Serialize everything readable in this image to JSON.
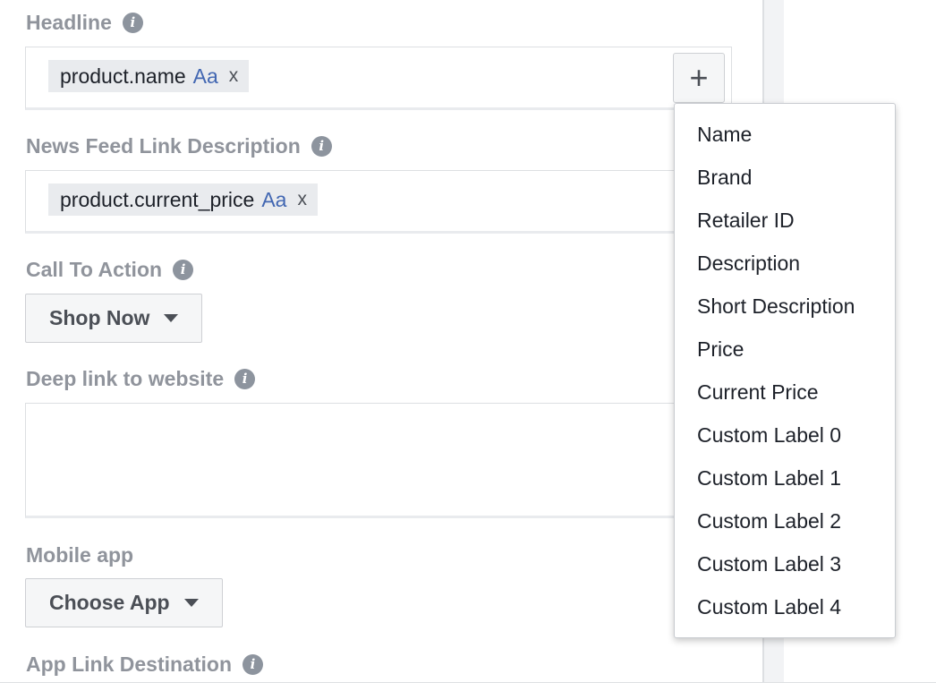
{
  "fields": {
    "headline": {
      "label": "Headline",
      "token": "product.name",
      "token_style": "Aa",
      "token_remove": "x"
    },
    "link_description": {
      "label": "News Feed Link Description",
      "token": "product.current_price",
      "token_style": "Aa",
      "token_remove": "x"
    },
    "call_to_action": {
      "label": "Call To Action",
      "value": "Shop Now"
    },
    "deep_link": {
      "label": "Deep link to website",
      "value": ""
    },
    "mobile_app": {
      "label": "Mobile app",
      "value": "Choose App"
    },
    "app_link_destination": {
      "label": "App Link Destination"
    }
  },
  "add_button": {
    "symbol": "+"
  },
  "menu": {
    "items": [
      "Name",
      "Brand",
      "Retailer ID",
      "Description",
      "Short Description",
      "Price",
      "Current Price",
      "Custom Label 0",
      "Custom Label 1",
      "Custom Label 2",
      "Custom Label 3",
      "Custom Label 4"
    ]
  },
  "icons": {
    "info": "info-icon",
    "caret": "caret-down-icon",
    "add": "plus-icon"
  },
  "colors": {
    "label": "#90949c",
    "token_bg": "#e9ebee",
    "accent": "#4267b2"
  }
}
